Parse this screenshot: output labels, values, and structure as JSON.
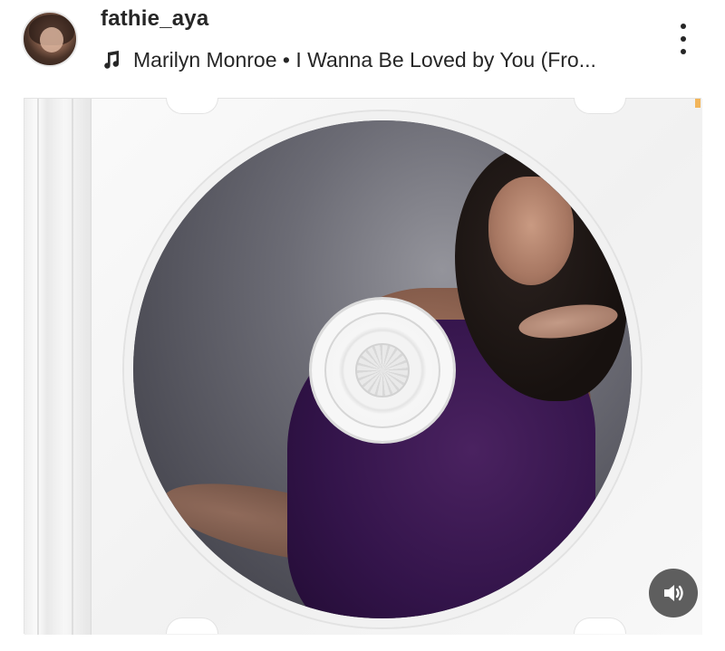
{
  "post_header": {
    "username": "fathie_aya",
    "music": "Marilyn Monroe • I Wanna Be Loved by You (Fro..."
  },
  "icons": {
    "avatar": "profile-avatar",
    "music": "music-note-icon",
    "more": "more-vertical-icon",
    "sound": "speaker-volume-icon"
  },
  "colors": {
    "text": "#262626",
    "sound_button_bg": "#3c3c3c",
    "accent_corner": "#f2b55a"
  }
}
